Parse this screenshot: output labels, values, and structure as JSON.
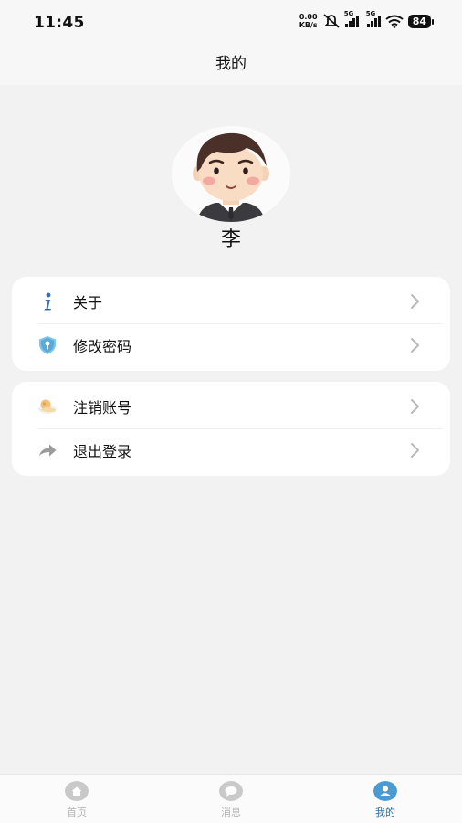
{
  "status_bar": {
    "time": "11:45",
    "net_speed_value": "0.00",
    "net_speed_unit": "KB/s",
    "sim1": "5G",
    "sim2": "5G",
    "battery": "84"
  },
  "header": {
    "title": "我的"
  },
  "profile": {
    "name": "李"
  },
  "menu_group_1": [
    {
      "label": "关于",
      "icon": "info-icon"
    },
    {
      "label": "修改密码",
      "icon": "shield-key-icon"
    }
  ],
  "menu_group_2": [
    {
      "label": "注销账号",
      "icon": "account-cancel-icon"
    },
    {
      "label": "退出登录",
      "icon": "logout-arrow-icon"
    }
  ],
  "tab_bar": {
    "tabs": [
      {
        "label": "首页",
        "icon": "home-icon",
        "active": false
      },
      {
        "label": "消息",
        "icon": "message-icon",
        "active": false
      },
      {
        "label": "我的",
        "icon": "user-icon",
        "active": true
      }
    ]
  },
  "colors": {
    "accent": "#3a8fc9",
    "inactive_tab": "#b5b5b5",
    "background": "#f2f2f2",
    "card": "#ffffff"
  }
}
